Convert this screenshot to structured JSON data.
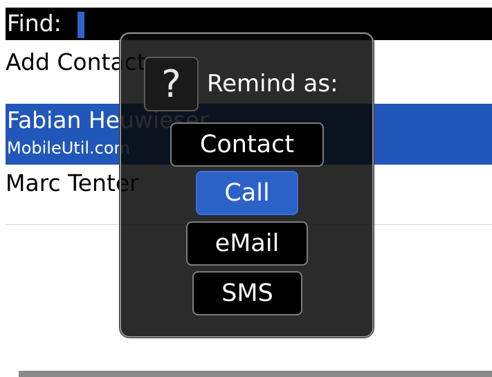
{
  "find": {
    "label": "Find:",
    "value": ""
  },
  "list": {
    "add_contact": "Add Contact",
    "selected": {
      "name": "Fabian Heuwieser",
      "subtitle": "MobileUtil.com"
    },
    "items": [
      "Marc Tenter"
    ]
  },
  "dialog": {
    "icon": "question-icon",
    "icon_glyph": "?",
    "title": "Remind as:",
    "options": [
      "Contact",
      "Call",
      "eMail",
      "SMS"
    ],
    "selected_option": "Call"
  },
  "colors": {
    "selection": "#2157b9",
    "button_selected": "#2c62c8",
    "caret": "#2f63c8"
  }
}
